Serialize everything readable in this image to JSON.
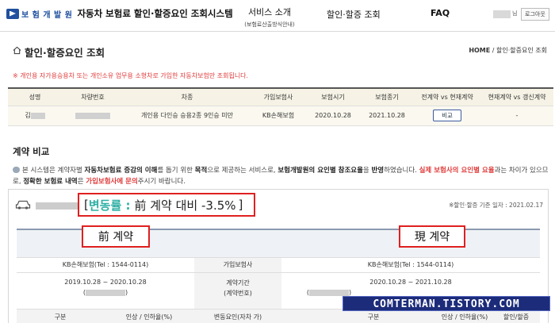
{
  "header": {
    "org_name": "보 험 개 발 원",
    "system_title": "자동차 보험료 할인·할증요인 조회시스템",
    "nav": [
      {
        "label": "서비스 소개",
        "sub": "(보험료산출방식안내)"
      },
      {
        "label": "할인·할증 조회"
      },
      {
        "label": "FAQ"
      }
    ],
    "user_suffix": "님",
    "logout_label": "로그아웃"
  },
  "page": {
    "title": "할인·할증요인 조회",
    "breadcrumb_home": "HOME",
    "breadcrumb_current": "할인·할증요인 조회",
    "notice": "※ 개인용 자가용승용차 또는 개인소유 업무용 소형차로 가입한 자동차보험만 조회됩니다."
  },
  "vehicle_table": {
    "headers": [
      "성명",
      "차량번호",
      "차종",
      "가입보험사",
      "보험시기",
      "보험종기",
      "전계약 vs 현재계약",
      "현재계약 vs 갱신계약"
    ],
    "row": {
      "name": "김",
      "vehicle_type": "개인용 다인승 승용2종 9인승 미만",
      "insurer": "KB손해보험",
      "start": "2020.10.28",
      "end": "2021.10.28",
      "compare_button": "비교",
      "renewal": "-"
    }
  },
  "comparison": {
    "section_title": "계약 비교",
    "desc_parts": [
      {
        "t": "본 시스템은 계약자별 ",
        "s": ""
      },
      {
        "t": "자동차보험료 증감의 이해",
        "s": "b"
      },
      {
        "t": "를 돕기 위한 ",
        "s": ""
      },
      {
        "t": "목적",
        "s": "b"
      },
      {
        "t": "으로 제공하는 서비스로, ",
        "s": ""
      },
      {
        "t": "보험개발원의 요인별 참조요율",
        "s": "b"
      },
      {
        "t": "을 ",
        "s": ""
      },
      {
        "t": "반영",
        "s": "b"
      },
      {
        "t": "하였습니다. ",
        "s": ""
      },
      {
        "t": "실제 보험사의 요인별 요율",
        "s": "r"
      },
      {
        "t": "과는 차이가 있으므로, ",
        "s": ""
      },
      {
        "t": "정확한 보험료 내역",
        "s": "b"
      },
      {
        "t": "은 ",
        "s": ""
      },
      {
        "t": "가입보험사에 문의",
        "s": "r"
      },
      {
        "t": "주시기 바랍니다.",
        "s": ""
      }
    ],
    "rate_label": "변동률 :",
    "rate_text": "前 계약 대비 -3.5%",
    "base_date": "※할인·할증 기준 일자 : 2021.02.17",
    "prev_label": "前 계약",
    "cur_label": "現 계약",
    "rows": {
      "insurer_prev": "KB손해보험(Tel : 1544-0114)",
      "insurer_label": "가입보험사",
      "insurer_cur": "KB손해보험(Tel : 1544-0114)",
      "period_prev": "2019.10.28 ~ 2020.10.28",
      "period_label": "계약기간",
      "period_label2": "(계약번호)",
      "period_cur": "2020.10.28 ~ 2021.10.28",
      "paren_open": "(",
      "paren_close": ")"
    },
    "sub_headers": {
      "col1": "구분",
      "col2": "인상 / 인하율(%)",
      "col3": "변동요인(자차 가)",
      "col4": "구분",
      "col5": "인상 / 인하율(%)",
      "col6": "할인/할증"
    }
  },
  "watermark": "COMTERMAN.TISTORY.COM"
}
